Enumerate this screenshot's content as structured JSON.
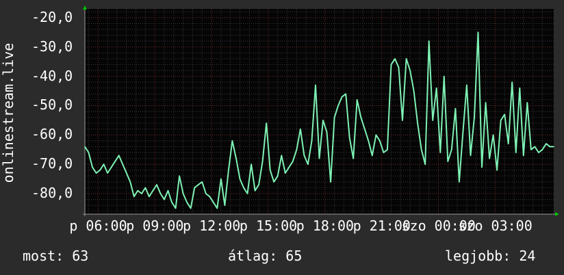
{
  "chart_data": {
    "type": "line",
    "ylabel": "onlinestream.live",
    "ylim": [
      -87,
      -17
    ],
    "y_ticks": [
      "-20,0",
      "-30,0",
      "-40,0",
      "-50,0",
      "-60,0",
      "-70,0",
      "-80,0"
    ],
    "y_tick_values": [
      -20,
      -30,
      -40,
      -50,
      -60,
      -70,
      -80
    ],
    "x_ticks": [
      "p 06:00",
      "p 09:00",
      "p 12:00",
      "p 15:00",
      "p 18:00",
      "p 21:00",
      "szo 00:00",
      "szo 03:00"
    ],
    "x_tick_positions": [
      0,
      3,
      6,
      9,
      12,
      15,
      18,
      21
    ],
    "xlim": [
      -0.7,
      24.1
    ],
    "grid": true,
    "line_color": "#7ef2b4",
    "series": [
      {
        "name": "",
        "x": [
          -0.7,
          -0.5,
          -0.3,
          -0.1,
          0.1,
          0.3,
          0.5,
          0.7,
          0.9,
          1.1,
          1.3,
          1.5,
          1.7,
          1.9,
          2.1,
          2.3,
          2.5,
          2.7,
          2.9,
          3.1,
          3.3,
          3.5,
          3.7,
          3.9,
          4.1,
          4.3,
          4.5,
          4.7,
          4.9,
          5.1,
          5.3,
          5.5,
          5.7,
          5.9,
          6.1,
          6.3,
          6.5,
          6.7,
          6.9,
          7.1,
          7.3,
          7.5,
          7.7,
          7.9,
          8.1,
          8.3,
          8.5,
          8.7,
          8.9,
          9.1,
          9.3,
          9.5,
          9.7,
          9.9,
          10.1,
          10.3,
          10.5,
          10.7,
          10.9,
          11.1,
          11.3,
          11.5,
          11.7,
          11.9,
          12.1,
          12.3,
          12.5,
          12.7,
          12.9,
          13.1,
          13.3,
          13.5,
          13.7,
          13.9,
          14.1,
          14.3,
          14.5,
          14.7,
          14.9,
          15.1,
          15.3,
          15.5,
          15.7,
          15.9,
          16.1,
          16.3,
          16.5,
          16.7,
          16.9,
          17.1,
          17.3,
          17.5,
          17.7,
          17.9,
          18.1,
          18.3,
          18.5,
          18.7,
          18.9,
          19.1,
          19.3,
          19.5,
          19.7,
          19.9,
          20.1,
          20.3,
          20.5,
          20.7,
          20.9,
          21.1,
          21.3,
          21.5,
          21.7,
          21.9,
          22.1,
          22.3,
          22.5,
          22.7,
          22.9,
          23.1,
          23.3,
          23.5,
          23.7,
          23.9,
          24.1
        ],
        "y": [
          -64,
          -66,
          -71,
          -73,
          -72,
          -70,
          -73,
          -71,
          -69,
          -67,
          -70,
          -73,
          -76,
          -81,
          -79,
          -80,
          -78,
          -81,
          -79,
          -77,
          -80,
          -82,
          -79,
          -83,
          -85,
          -74,
          -80,
          -83,
          -85,
          -78,
          -77,
          -76,
          -80,
          -81,
          -83,
          -85,
          -75,
          -84,
          -72,
          -62,
          -68,
          -75,
          -78,
          -80,
          -70,
          -79,
          -77,
          -69,
          -56,
          -72,
          -76,
          -74,
          -67,
          -73,
          -71,
          -69,
          -65,
          -58,
          -67,
          -70,
          -62,
          -43,
          -68,
          -55,
          -59,
          -76,
          -54,
          -50,
          -47,
          -46,
          -61,
          -68,
          -48,
          -54,
          -58,
          -62,
          -67,
          -60,
          -62,
          -66,
          -65,
          -36,
          -34,
          -37,
          -55,
          -34,
          -38,
          -45,
          -56,
          -65,
          -70,
          -28,
          -55,
          -44,
          -66,
          -40,
          -69,
          -65,
          -51,
          -76,
          -59,
          -43,
          -67,
          -54,
          -25,
          -71,
          -49,
          -68,
          -60,
          -72,
          -55,
          -53,
          -63,
          -42,
          -66,
          -44,
          -67,
          -49,
          -65,
          -64,
          -66,
          -65,
          -63,
          -64,
          -64
        ]
      }
    ]
  },
  "stats": {
    "current": "most: 63",
    "average": "átlag: 65",
    "best": "legjobb: 24"
  }
}
